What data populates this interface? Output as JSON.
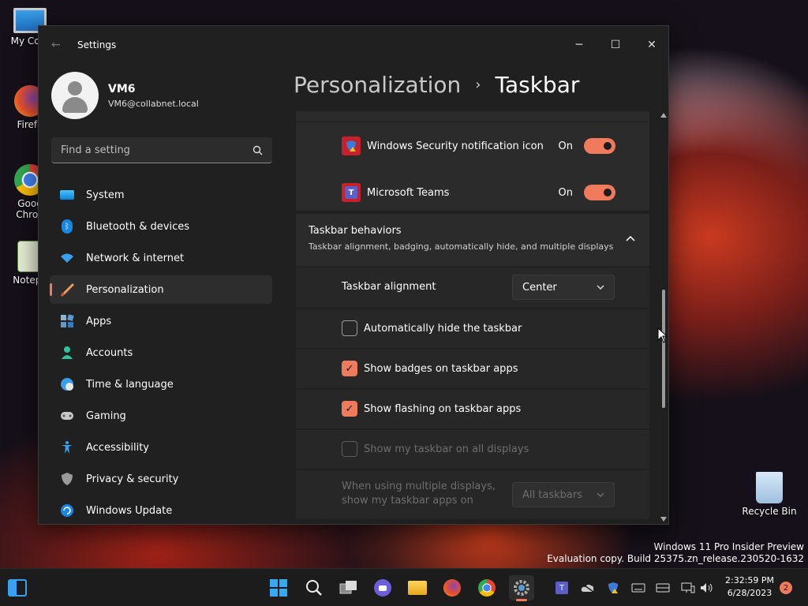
{
  "desktop": {
    "icons": [
      {
        "label": "My Com",
        "icon": "computer-icon"
      },
      {
        "label": "Firefo",
        "icon": "firefox-icon"
      },
      {
        "label": "Goog Chron",
        "icon": "chrome-icon"
      },
      {
        "label": "Notepa",
        "icon": "notepad-icon"
      },
      {
        "label": "Recycle Bin",
        "icon": "recycle-bin-icon"
      }
    ],
    "watermark": {
      "line1": "Windows 11 Pro Insider Preview",
      "line2": "Evaluation copy. Build 25375.zn_release.230520-1632"
    }
  },
  "window": {
    "title": "Settings",
    "controls": {
      "minimize": "─",
      "maximize": "☐",
      "close": "✕"
    }
  },
  "profile": {
    "name": "VM6",
    "email": "VM6@collabnet.local"
  },
  "search": {
    "placeholder": "Find a setting"
  },
  "nav": [
    {
      "label": "System",
      "icon": "system-icon",
      "selected": false
    },
    {
      "label": "Bluetooth & devices",
      "icon": "bluetooth-icon",
      "selected": false
    },
    {
      "label": "Network & internet",
      "icon": "wifi-icon",
      "selected": false
    },
    {
      "label": "Personalization",
      "icon": "brush-icon",
      "selected": true
    },
    {
      "label": "Apps",
      "icon": "apps-icon",
      "selected": false
    },
    {
      "label": "Accounts",
      "icon": "accounts-icon",
      "selected": false
    },
    {
      "label": "Time & language",
      "icon": "globe-clock-icon",
      "selected": false
    },
    {
      "label": "Gaming",
      "icon": "gamepad-icon",
      "selected": false
    },
    {
      "label": "Accessibility",
      "icon": "accessibility-icon",
      "selected": false
    },
    {
      "label": "Privacy & security",
      "icon": "shield-icon",
      "selected": false
    },
    {
      "label": "Windows Update",
      "icon": "update-icon",
      "selected": false
    }
  ],
  "breadcrumb": {
    "parent": "Personalization",
    "separator": "›",
    "current": "Taskbar"
  },
  "tray_icons_section": {
    "items": [
      {
        "label": "Windows Security notification icon",
        "state": "On",
        "icon": "windows-security-icon"
      },
      {
        "label": "Microsoft Teams",
        "state": "On",
        "icon": "teams-icon"
      }
    ]
  },
  "behaviors": {
    "title": "Taskbar behaviors",
    "subtitle": "Taskbar alignment, badging, automatically hide, and multiple displays",
    "alignment": {
      "label": "Taskbar alignment",
      "value": "Center"
    },
    "options": [
      {
        "label": "Automatically hide the taskbar",
        "checked": false,
        "disabled": false
      },
      {
        "label": "Show badges on taskbar apps",
        "checked": true,
        "disabled": false
      },
      {
        "label": "Show flashing on taskbar apps",
        "checked": true,
        "disabled": false
      },
      {
        "label": "Show my taskbar on all displays",
        "checked": false,
        "disabled": true
      }
    ],
    "multi_display": {
      "label_line1": "When using multiple displays,",
      "label_line2": "show my taskbar apps on",
      "value": "All taskbars"
    }
  },
  "taskbar": {
    "clock_time": "2:32:59 PM",
    "clock_date": "6/28/2023",
    "notification_count": "2"
  },
  "colors": {
    "accent": "#ef7a5c",
    "window_bg": "#202020",
    "card_bg": "#2b2b2b"
  }
}
